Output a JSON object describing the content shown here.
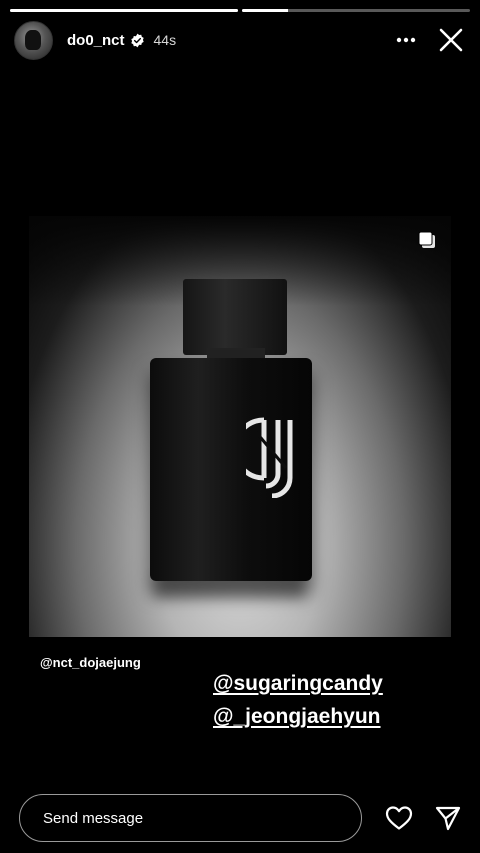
{
  "progress": {
    "segments": [
      1,
      0.2
    ]
  },
  "header": {
    "username": "do0_nct",
    "time": "44s",
    "verified_icon": "verified-badge-icon",
    "more_icon": "more-horizontal-icon",
    "close_icon": "close-icon"
  },
  "post": {
    "multi_icon": "multiple-photos-icon",
    "logo_text": "DJ"
  },
  "mentions": {
    "small": "@nct_dojaejung",
    "line1": "@sugaringcandy",
    "line2": "@_jeongjaehyun"
  },
  "footer": {
    "send_placeholder": "Send message",
    "like_icon": "heart-icon",
    "share_icon": "send-icon"
  }
}
